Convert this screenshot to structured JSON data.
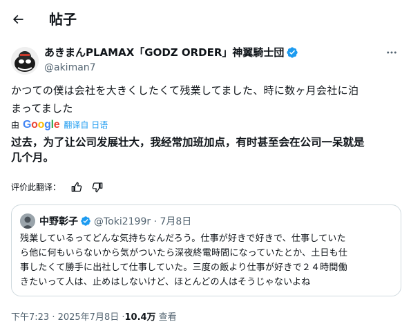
{
  "header": {
    "title": "帖子",
    "back_icon": "arrow-left-icon"
  },
  "author": {
    "name": "あきまんPLAMAX「GODZ ORDER」神翼騎士団",
    "handle": "@akiman7",
    "verified_color": "#1d9bf0",
    "more_icon": "more-horizontal-icon"
  },
  "post": {
    "original_line1": "かつての僕は会社を大きくしたくて残業してました、時に数ヶ月会社に泊",
    "original_line2": "まってました",
    "translate_by": "由",
    "translate_provider": "Google",
    "translate_link": "翻译自 日语",
    "translated_line1": "过去，为了让公司发展壮大，我经常加班加点，有时甚至会在公司一呆就是",
    "translated_line2": "几个月。"
  },
  "rating": {
    "label": "评价此翻译：",
    "thumbs_up_icon": "thumbs-up-icon",
    "thumbs_down_icon": "thumbs-down-icon"
  },
  "quote": {
    "name": "中野彰子",
    "handle_date": "@Toki2199r · 7月8日",
    "line1": "残業しているってどんな気持ちなんだろう。仕事が好きで好きで、仕事していた",
    "line2": "ら他に何もいらないから気がついたら深夜終電時間になっていたとか、土日も仕",
    "line3": "事したくて勝手に出社して仕事していた。三度の飯より仕事が好きで２４時間働",
    "line4": "きたいって人は、止めはしないけど、ほとんどの人はそうじゃないよね"
  },
  "footer": {
    "time_date": "下午7:23 · 2025年7月8日 · ",
    "views_count": "10.4万",
    "views_label": "查看"
  },
  "colors": {
    "accent": "#1d9bf0",
    "text": "#0f1419",
    "muted": "#536471",
    "border": "#cfd9de"
  }
}
